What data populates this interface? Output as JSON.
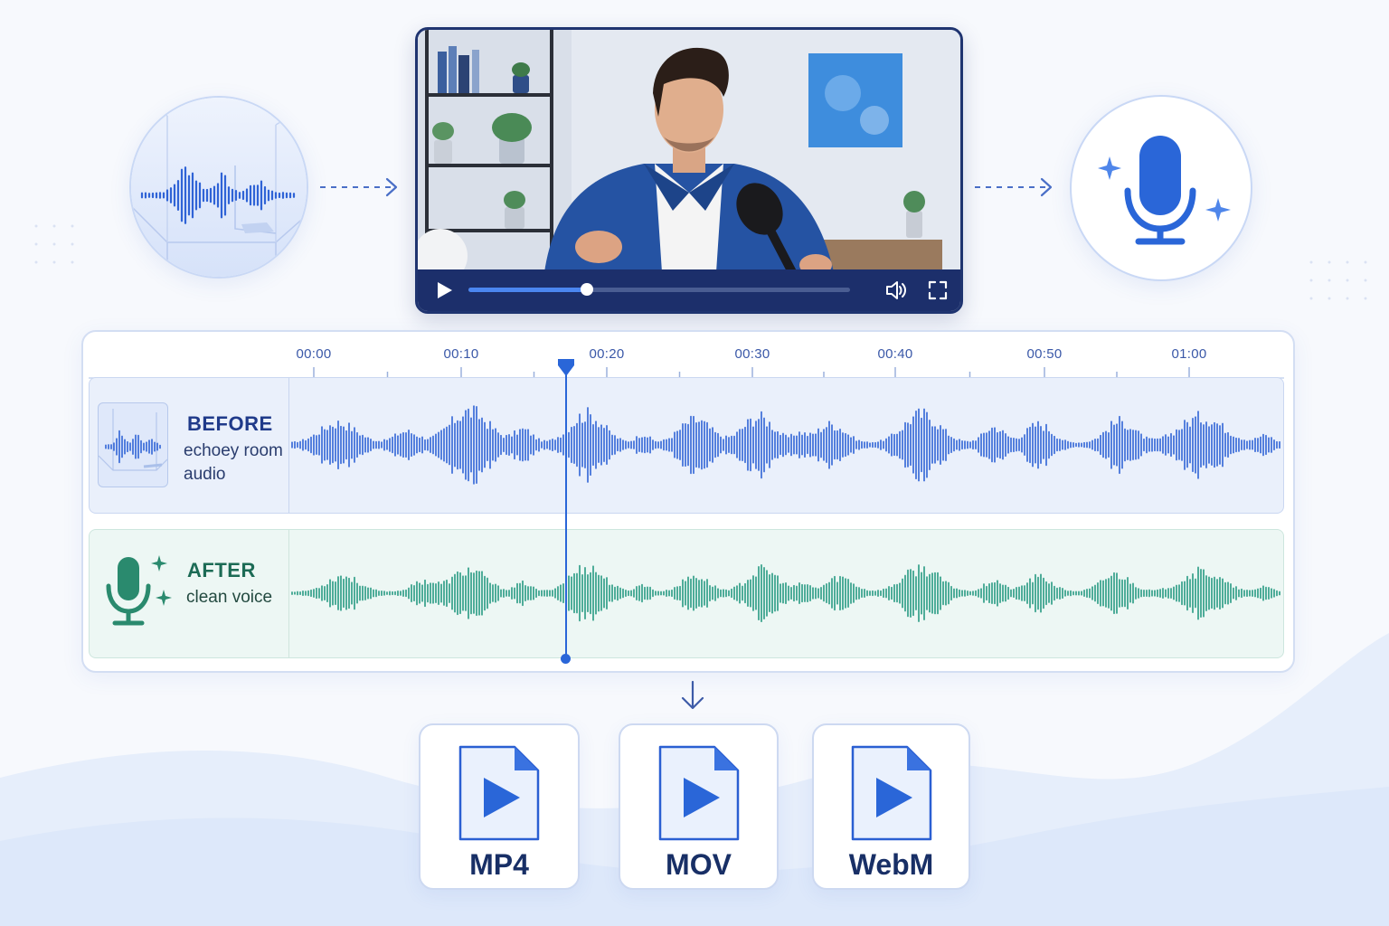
{
  "video_player": {
    "progress": 0.31
  },
  "timeline": {
    "ruler_labels": [
      "00:00",
      "00:10",
      "00:20",
      "00:30",
      "00:40",
      "00:50",
      "01:00"
    ],
    "tracks": {
      "before": {
        "title": "BEFORE",
        "subtitle": "echoey room audio"
      },
      "after": {
        "title": "AFTER",
        "subtitle": "clean voice"
      }
    }
  },
  "export_formats": [
    {
      "label": "MP4"
    },
    {
      "label": "MOV"
    },
    {
      "label": "WebM"
    }
  ],
  "colors": {
    "before_wave": "#2f63d6",
    "after_wave": "#279a82",
    "accent": "#2a66d8",
    "player_bar": "#1c2f6b"
  },
  "icons": {
    "room_circle": "echo-room-waveform-icon",
    "voice_circle": "sparkle-microphone-icon",
    "after_track": "clean-microphone-icon",
    "export": "video-file-play-icon"
  }
}
